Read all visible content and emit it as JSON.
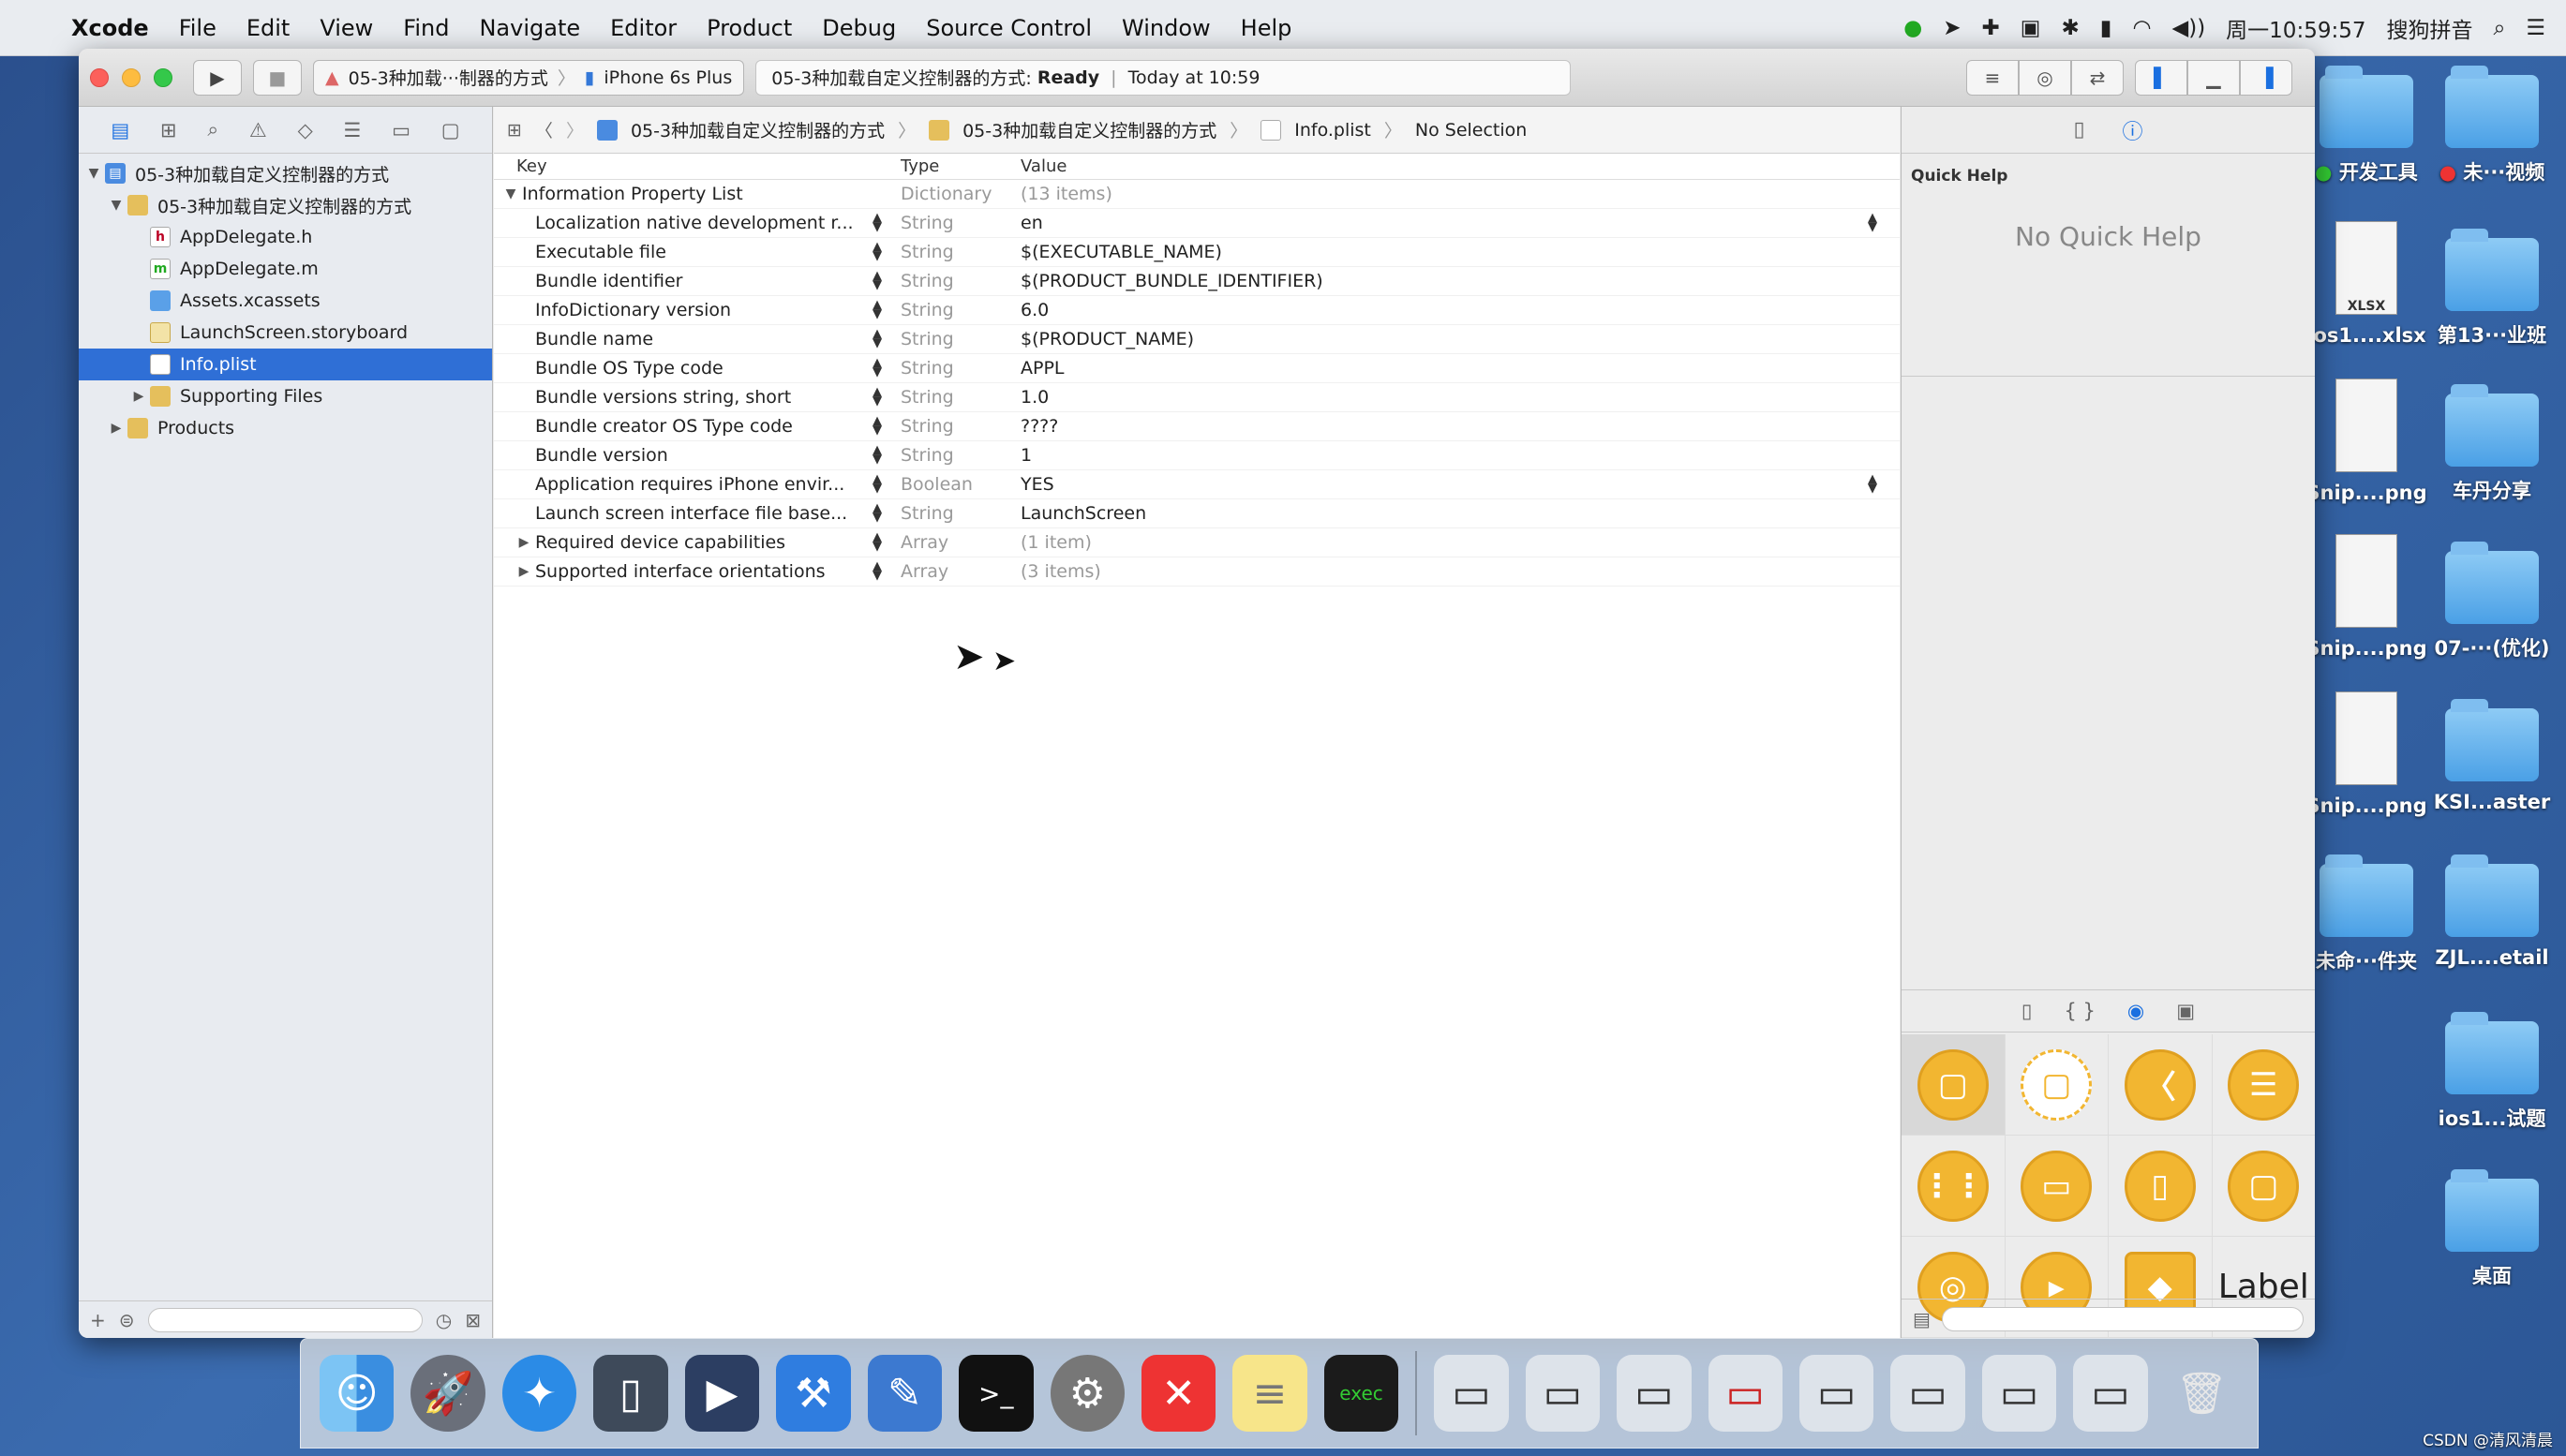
{
  "menubar": {
    "app": "Xcode",
    "items": [
      "File",
      "Edit",
      "View",
      "Find",
      "Navigate",
      "Editor",
      "Product",
      "Debug",
      "Source Control",
      "Window",
      "Help"
    ],
    "clock": "周一10:59:57",
    "input_method": "搜狗拼音"
  },
  "toolbar": {
    "scheme": "05-3种加载···制器的方式",
    "device": "iPhone 6s Plus",
    "status_project": "05-3种加载自定义控制器的方式:",
    "status_state": "Ready",
    "status_time": "Today at 10:59"
  },
  "navigator": {
    "tree": [
      {
        "label": "05-3种加载自定义控制器的方式",
        "indent": 0,
        "icon": "project",
        "disclosure": "▼"
      },
      {
        "label": "05-3种加载自定义控制器的方式",
        "indent": 1,
        "icon": "folder",
        "disclosure": "▼"
      },
      {
        "label": "AppDelegate.h",
        "indent": 2,
        "icon": "h"
      },
      {
        "label": "AppDelegate.m",
        "indent": 2,
        "icon": "m"
      },
      {
        "label": "Assets.xcassets",
        "indent": 2,
        "icon": "assets"
      },
      {
        "label": "LaunchScreen.storyboard",
        "indent": 2,
        "icon": "storyboard"
      },
      {
        "label": "Info.plist",
        "indent": 2,
        "icon": "plist",
        "selected": true
      },
      {
        "label": "Supporting Files",
        "indent": 2,
        "icon": "folder",
        "disclosure": "▶"
      },
      {
        "label": "Products",
        "indent": 1,
        "icon": "folder",
        "disclosure": "▶"
      }
    ]
  },
  "jumpbar": {
    "crumbs": [
      "05-3种加载自定义控制器的方式",
      "05-3种加载自定义控制器的方式",
      "Info.plist",
      "No Selection"
    ]
  },
  "plist": {
    "headers": {
      "key": "Key",
      "type": "Type",
      "value": "Value"
    },
    "root": {
      "key": "Information Property List",
      "type": "Dictionary",
      "value": "(13 items)"
    },
    "rows": [
      {
        "key": "Localization native development r...",
        "type": "String",
        "value": "en",
        "popup": true
      },
      {
        "key": "Executable file",
        "type": "String",
        "value": "$(EXECUTABLE_NAME)"
      },
      {
        "key": "Bundle identifier",
        "type": "String",
        "value": "$(PRODUCT_BUNDLE_IDENTIFIER)"
      },
      {
        "key": "InfoDictionary version",
        "type": "String",
        "value": "6.0"
      },
      {
        "key": "Bundle name",
        "type": "String",
        "value": "$(PRODUCT_NAME)"
      },
      {
        "key": "Bundle OS Type code",
        "type": "String",
        "value": "APPL"
      },
      {
        "key": "Bundle versions string, short",
        "type": "String",
        "value": "1.0"
      },
      {
        "key": "Bundle creator OS Type code",
        "type": "String",
        "value": "????"
      },
      {
        "key": "Bundle version",
        "type": "String",
        "value": "1"
      },
      {
        "key": "Application requires iPhone envir...",
        "type": "Boolean",
        "value": "YES",
        "popup": true
      },
      {
        "key": "Launch screen interface file base...",
        "type": "String",
        "value": "LaunchScreen"
      },
      {
        "key": "Required device capabilities",
        "type": "Array",
        "value": "(1 item)",
        "expandable": true
      },
      {
        "key": "Supported interface orientations",
        "type": "Array",
        "value": "(3 items)",
        "expandable": true
      }
    ]
  },
  "inspector": {
    "title": "Quick Help",
    "empty": "No Quick Help",
    "library_label": "Label"
  },
  "desktop": [
    {
      "label": "开发工具",
      "kind": "folder",
      "dot": "#3c3"
    },
    {
      "label": "未···视频",
      "kind": "folder",
      "dot": "#e33"
    },
    {
      "label": "ios1....xlsx",
      "kind": "file",
      "badge": "XLSX"
    },
    {
      "label": "第13···业班",
      "kind": "folder"
    },
    {
      "label": "Snip....png",
      "kind": "file"
    },
    {
      "label": "车丹分享",
      "kind": "folder"
    },
    {
      "label": "Snip....png",
      "kind": "file"
    },
    {
      "label": "07-···(优化)",
      "kind": "folder"
    },
    {
      "label": "Snip....png",
      "kind": "file"
    },
    {
      "label": "KSI...aster",
      "kind": "folder"
    },
    {
      "label": "未命···件夹",
      "kind": "folder"
    },
    {
      "label": "ZJL....etail",
      "kind": "folder"
    },
    {
      "label": "ios1...试题",
      "kind": "folder"
    },
    {
      "label": "桌面",
      "kind": "folder"
    }
  ],
  "watermark": "CSDN @清风清晨"
}
